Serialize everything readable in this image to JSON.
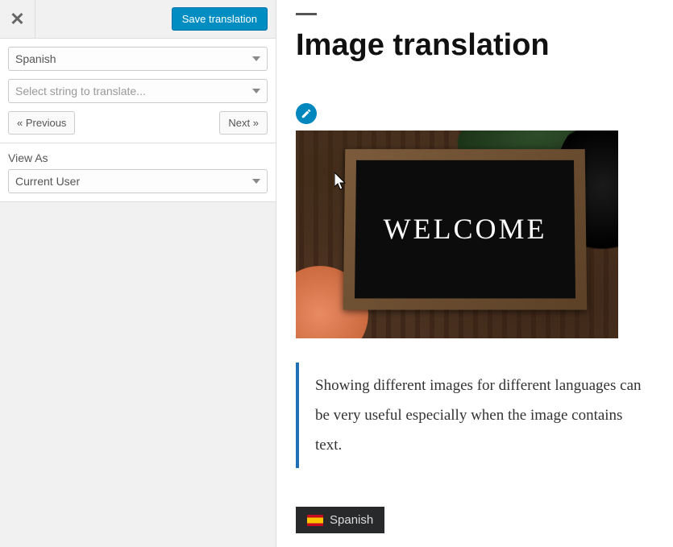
{
  "toolbar": {
    "save_label": "Save translation"
  },
  "sidebar": {
    "language_value": "Spanish",
    "string_placeholder": "Select string to translate...",
    "prev_label": "« Previous",
    "next_label": "Next »",
    "viewas_label": "View As",
    "viewas_value": "Current User"
  },
  "page": {
    "title": "Image translation",
    "board_text": "WELCOME",
    "quote": "Showing different images for different languages can be very useful especially when the image contains text."
  },
  "lang_switcher": {
    "current": "Spanish"
  }
}
